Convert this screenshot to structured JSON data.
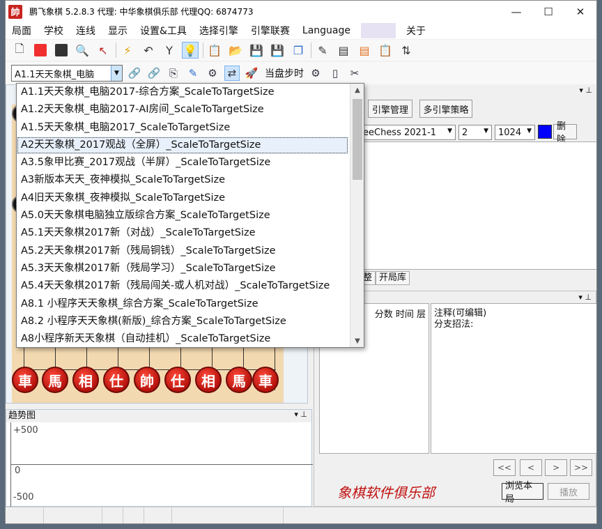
{
  "window": {
    "app_icon_char": "帥",
    "title": "鹏飞象棋 5.2.8.3   代理: 中华象棋俱乐部   代理QQ: 6874773",
    "minimize": "—",
    "maximize": "☐",
    "close": "✕"
  },
  "menu": [
    "局面",
    "学校",
    "连线",
    "显示",
    "设置&工具",
    "选择引擎",
    "引擎联赛",
    "Language",
    "关于"
  ],
  "toolbar2": {
    "combo_value": "A1.1天天象棋_电脑",
    "step_label": "当盘步时"
  },
  "right_panel": {
    "engine_manage": "引擎管理",
    "multi_engine": "多引擎策略",
    "engine_name": "eeChess 2021-1",
    "threads": "2",
    "hash": "1024",
    "delete": "删除",
    "tab_partial": "整",
    "tab_opening": "开局库",
    "move_header": "分数 时间 层",
    "notes_line1": "注释(可编辑)",
    "notes_line2": "分支招法:",
    "nav_first": "<<",
    "nav_prev": "<",
    "nav_next": ">",
    "nav_last": ">>",
    "browse": "浏览本局",
    "play": "播放",
    "signature": "象棋软件俱乐部"
  },
  "trend": {
    "title": "趋势图",
    "labels": [
      "+500",
      "0",
      "-500"
    ]
  },
  "board": {
    "red_pieces": [
      "車",
      "馬",
      "相",
      "仕",
      "帥",
      "仕",
      "相",
      "馬",
      "車"
    ]
  },
  "dropdown": {
    "items": [
      "A1.1天天象棋_电脑2017-综合方案_ScaleToTargetSize",
      "A1.2天天象棋_电脑2017-AI房间_ScaleToTargetSize",
      "A1.5天天象棋_电脑2017_ScaleToTargetSize",
      "A2天天象棋_2017观战（全屏）_ScaleToTargetSize",
      "A3.5象甲比赛_2017观战（半屏）_ScaleToTargetSize",
      "A3新版本天天_夜神模拟_ScaleToTargetSize",
      "A4旧天天象棋_夜神模拟_ScaleToTargetSize",
      "A5.0天天象棋电脑独立版综合方案_ScaleToTargetSize",
      "A5.1天天象棋2017新（对战）_ScaleToTargetSize",
      "A5.2天天象棋2017新（残局铜钱）_ScaleToTargetSize",
      "A5.3天天象棋2017新（残局学习）_ScaleToTargetSize",
      "A5.4天天象棋2017新（残局闯关-或人机对战）_ScaleToTargetSize",
      "A8.1 小程序天天象棋_综合方案_ScaleToTargetSize",
      "A8.2 小程序天天象棋(新版)_综合方案_ScaleToTargetSize",
      "A8小程序新天天象棋（自动挂机）_ScaleToTargetSize"
    ],
    "selected_index": 3
  }
}
